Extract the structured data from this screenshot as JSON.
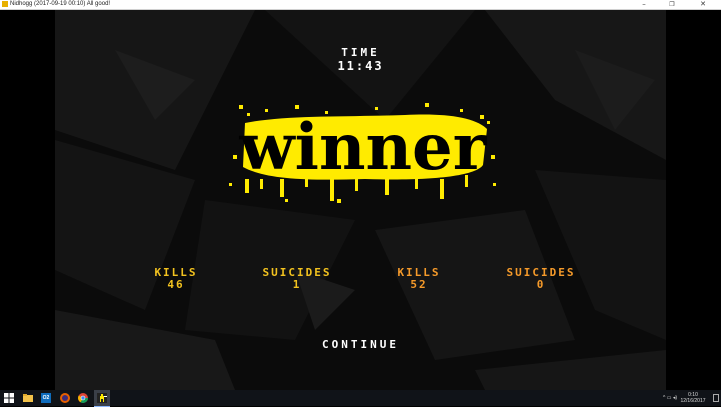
{
  "window": {
    "title": "Nidhogg (2017-09-19 00:10) All good!",
    "minimize_glyph": "–",
    "maximize_glyph": "❐",
    "close_glyph": "✕"
  },
  "hud": {
    "time_label": "TIME",
    "time_value": "11:43"
  },
  "banner": {
    "text": "winner",
    "color": "#ffeb00"
  },
  "stats": {
    "player1": {
      "kills_label": "KILLS",
      "kills": "46",
      "suicides_label": "SUICIDES",
      "suicides": "1",
      "color": "#f2c21f"
    },
    "player2": {
      "kills_label": "KILLS",
      "kills": "52",
      "suicides_label": "SUICIDES",
      "suicides": "0",
      "color": "#f59a2a"
    }
  },
  "continue_label": "CONTINUE",
  "taskbar": {
    "apps": [
      "windows-start-icon",
      "file-explorer-icon",
      "outlook-icon",
      "firefox-icon",
      "chrome-icon",
      "nidhogg-icon"
    ],
    "outlook_badge": "O2",
    "clock_time": "0:10",
    "clock_date": "12/16/2017"
  }
}
